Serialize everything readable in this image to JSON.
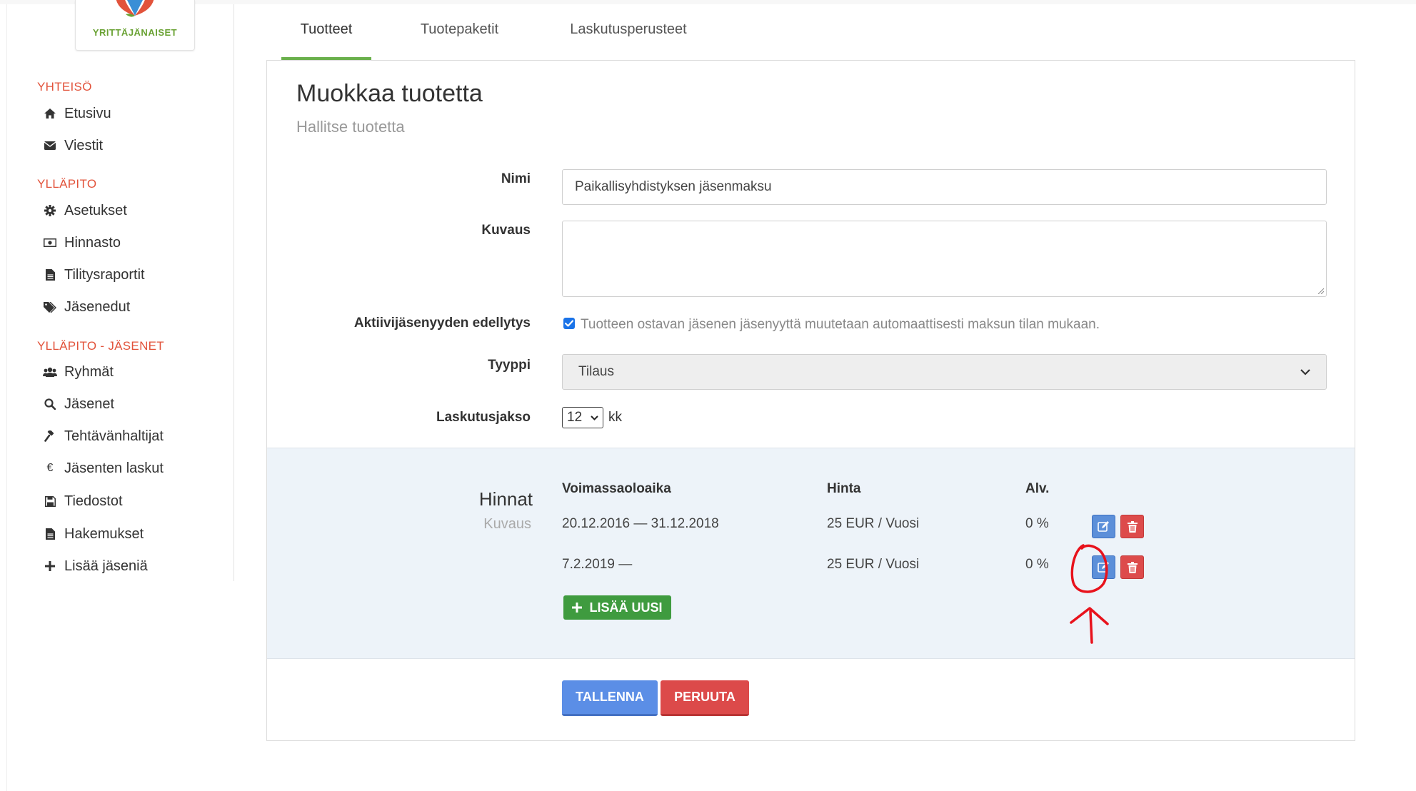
{
  "brand": {
    "logo_text": "YRITTÄJÄNAISET"
  },
  "sidebar": {
    "sections": [
      {
        "title": "YHTEISÖ",
        "items": [
          {
            "label": "Etusivu",
            "icon": "home-icon"
          },
          {
            "label": "Viestit",
            "icon": "envelope-icon"
          }
        ]
      },
      {
        "title": "YLLÄPITO",
        "items": [
          {
            "label": "Asetukset",
            "icon": "gear-icon"
          },
          {
            "label": "Hinnasto",
            "icon": "money-icon"
          },
          {
            "label": "Tilitysraportit",
            "icon": "file-icon"
          },
          {
            "label": "Jäsenedut",
            "icon": "tags-icon"
          }
        ]
      },
      {
        "title": "YLLÄPITO - JÄSENET",
        "items": [
          {
            "label": "Ryhmät",
            "icon": "users-icon"
          },
          {
            "label": "Jäsenet",
            "icon": "search-icon"
          },
          {
            "label": "Tehtävänhaltijat",
            "icon": "gavel-icon"
          },
          {
            "label": "Jäsenten laskut",
            "icon": "euro-icon"
          },
          {
            "label": "Tiedostot",
            "icon": "save-icon"
          },
          {
            "label": "Hakemukset",
            "icon": "file-icon"
          },
          {
            "label": "Lisää jäseniä",
            "icon": "plus-icon"
          }
        ]
      }
    ],
    "icons": {
      "euro_glyph": "€"
    }
  },
  "tabs": [
    {
      "label": "Tuotteet",
      "active": true
    },
    {
      "label": "Tuotepaketit",
      "active": false
    },
    {
      "label": "Laskutusperusteet",
      "active": false
    }
  ],
  "page": {
    "title": "Muokkaa tuotetta",
    "subtitle": "Hallitse tuotetta"
  },
  "form": {
    "name_label": "Nimi",
    "name_value": "Paikallisyhdistyksen jäsenmaksu",
    "description_label": "Kuvaus",
    "description_value": "",
    "active_label": "Aktiivijäsenyyden edellytys",
    "active_checked": true,
    "active_text": "Tuotteen ostavan jäsenen jäsenyyttä muutetaan automaattisesti maksun tilan mukaan.",
    "type_label": "Tyyppi",
    "type_value": "Tilaus",
    "period_label": "Laskutusjakso",
    "period_value": "12",
    "period_unit": "kk"
  },
  "prices": {
    "title": "Hinnat",
    "description": "Kuvaus",
    "headers": {
      "validity": "Voimassaoloaika",
      "price": "Hinta",
      "vat": "Alv."
    },
    "rows": [
      {
        "validity": "20.12.2016 — 31.12.2018",
        "price": "25 EUR / Vuosi",
        "vat": "0 %"
      },
      {
        "validity": "7.2.2019 —",
        "price": "25 EUR / Vuosi",
        "vat": "0 %"
      }
    ],
    "add_label": "LISÄÄ UUSI"
  },
  "actions": {
    "save_label": "TALLENNA",
    "cancel_label": "PERUUTA"
  },
  "colors": {
    "accent_green": "#6ab04c",
    "section_red": "#e2533b",
    "edit_blue": "#5c8fd9",
    "delete_red": "#dd4b4b",
    "annotation_red": "#e8121c"
  }
}
